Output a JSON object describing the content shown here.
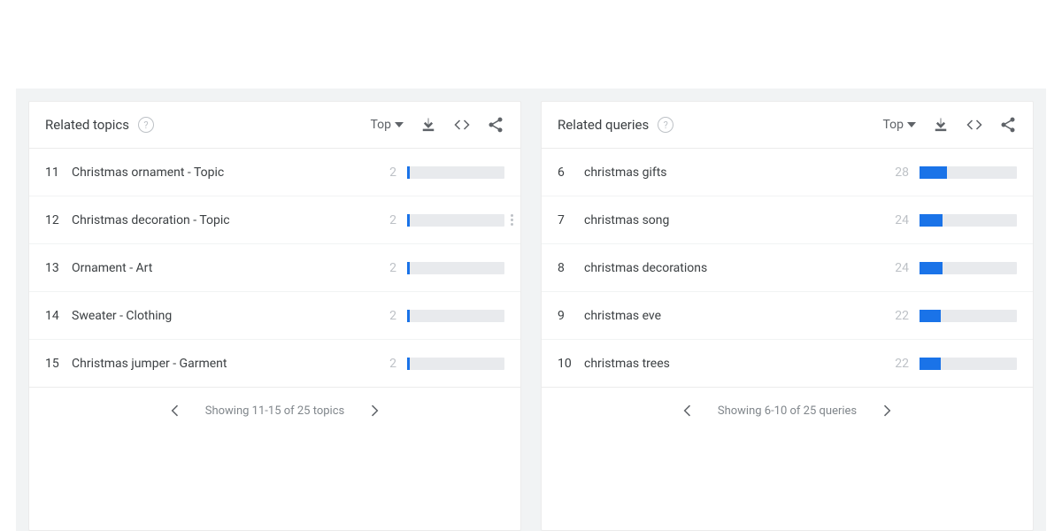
{
  "sort_label": "Top",
  "panels": [
    {
      "title": "Related topics",
      "rows": [
        {
          "rank": "11",
          "label": "Christmas ornament - Topic",
          "score": "2",
          "fill": 3,
          "menu": false
        },
        {
          "rank": "12",
          "label": "Christmas decoration - Topic",
          "score": "2",
          "fill": 3,
          "menu": true
        },
        {
          "rank": "13",
          "label": "Ornament - Art",
          "score": "2",
          "fill": 3,
          "menu": false
        },
        {
          "rank": "14",
          "label": "Sweater - Clothing",
          "score": "2",
          "fill": 3,
          "menu": false
        },
        {
          "rank": "15",
          "label": "Christmas jumper - Garment",
          "score": "2",
          "fill": 3,
          "menu": false
        }
      ],
      "pager": "Showing 11-15 of 25 topics"
    },
    {
      "title": "Related queries",
      "rows": [
        {
          "rank": "6",
          "label": "christmas gifts",
          "score": "28",
          "fill": 28,
          "menu": false
        },
        {
          "rank": "7",
          "label": "christmas song",
          "score": "24",
          "fill": 24,
          "menu": false
        },
        {
          "rank": "8",
          "label": "christmas decorations",
          "score": "24",
          "fill": 24,
          "menu": false
        },
        {
          "rank": "9",
          "label": "christmas eve",
          "score": "22",
          "fill": 22,
          "menu": false
        },
        {
          "rank": "10",
          "label": "christmas trees",
          "score": "22",
          "fill": 22,
          "menu": false
        }
      ],
      "pager": "Showing 6-10 of 25 queries"
    }
  ]
}
